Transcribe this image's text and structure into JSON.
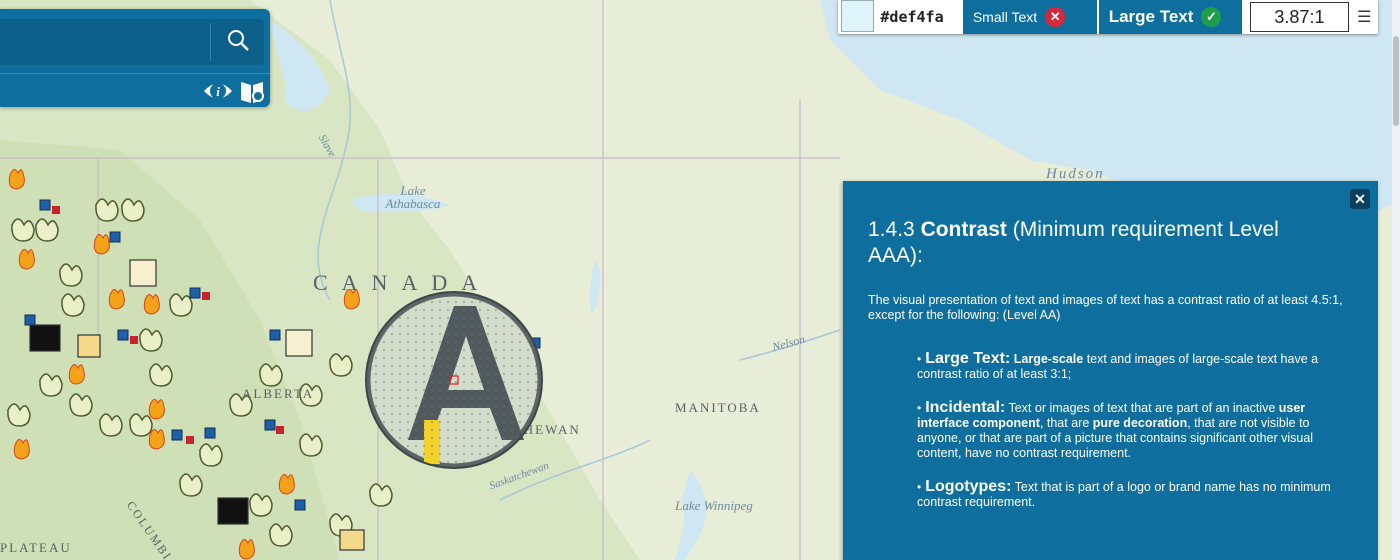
{
  "search": {
    "placeholder": "",
    "value": ""
  },
  "map_labels": {
    "country": "CANADA",
    "provinces": [
      "ALBERTA",
      "MANITOBA",
      "SASKATCHEWAN"
    ],
    "lakes": [
      "Lake Athabasca",
      "Lake Winnipeg",
      "Hudson"
    ],
    "rivers": [
      "Slave",
      "Nelson",
      "Saskatchewan"
    ],
    "other": [
      "PLATEAU",
      "COLUMBIA"
    ]
  },
  "contrast_checker": {
    "swatch_color": "#def4fa",
    "hex_value": "#def4fa",
    "small_text_label": "Small Text",
    "small_text_status": "fail",
    "large_text_label": "Large Text",
    "large_text_status": "pass",
    "ratio": "3.87:1"
  },
  "info_panel": {
    "criterion_number": "1.4.3",
    "criterion_name": "Contrast",
    "criterion_suffix": "(Minimum requirement Level AAA):",
    "description": "The visual presentation of text and images of text has a contrast ratio of at least 4.5:1, except for the following: (Level AA)",
    "items": [
      {
        "term": "Large Text:",
        "text_parts": [
          "",
          "Large-scale",
          " text and images of large-scale text have a contrast ratio of at least 3:1;"
        ]
      },
      {
        "term": "Incidental:",
        "text_parts": [
          " Text or images of text that are part of an inactive ",
          "user interface component",
          ", that are ",
          "pure decoration",
          ", that are not visible to anyone, or that are part of a picture that contains significant other visual content, have no contrast requirement."
        ]
      },
      {
        "term": "Logotypes:",
        "text_parts": [
          " Text that is part of a logo or brand name has no minimum contrast requirement."
        ]
      }
    ]
  },
  "colors": {
    "panel_blue": "#0e6f9e",
    "pass_green": "#1e9e4a",
    "fail_red": "#d8263a",
    "water": "#cfe7f2",
    "land": "#e7edd7"
  }
}
